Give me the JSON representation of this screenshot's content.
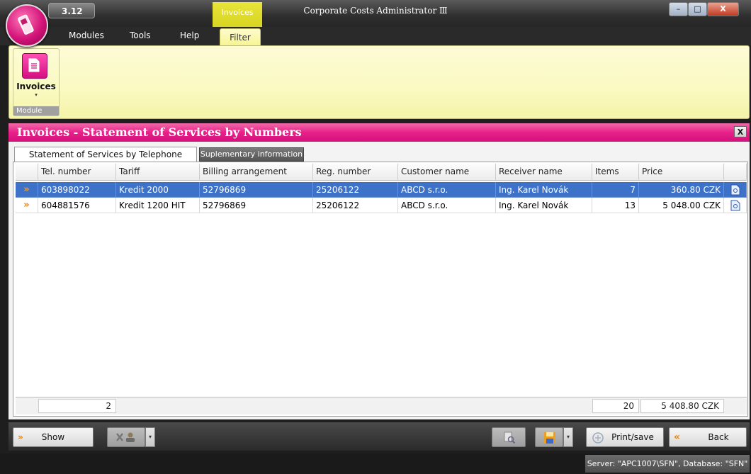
{
  "window": {
    "version": "3.12",
    "context_tab": "Invoices",
    "title": "Corporate Costs Administrator Ⅲ",
    "buttons": {
      "minimize": "–",
      "maximize": "□",
      "close": "X"
    }
  },
  "menu": {
    "items": [
      "Modules",
      "Tools",
      "Help"
    ],
    "active": "Filter"
  },
  "ribbon": {
    "button_label": "Invoices",
    "dropdown_arrow": "▾",
    "group_label": "Module"
  },
  "module": {
    "title": "Invoices - Statement of Services by  Numbers",
    "close_label": "X",
    "tabs": [
      "Statement of Services by Telephone Numbers",
      "Suplementary information"
    ]
  },
  "table": {
    "columns": [
      "Tel. number",
      "Tariff",
      "Billing arrangement",
      "Reg. number",
      "Customer name",
      "Receiver name",
      "Items",
      "Price"
    ],
    "rows": [
      {
        "tel": "603898022",
        "tariff": "Kredit 2000",
        "billing": "52796869",
        "reg": "25206122",
        "customer": "ABCD s.r.o.",
        "receiver": "Ing. Karel Novák",
        "items": "7",
        "price": "360.80 CZK",
        "selected": true
      },
      {
        "tel": "604881576",
        "tariff": "Kredit 1200 HIT",
        "billing": "52796869",
        "reg": "25206122",
        "customer": "ABCD s.r.o.",
        "receiver": "Ing. Karel Novák",
        "items": "13",
        "price": "5 048.00 CZK",
        "selected": false
      }
    ],
    "row_marker": "»",
    "totals": {
      "count": "2",
      "items": "20",
      "price": "5 408.80 CZK"
    }
  },
  "toolbar": {
    "show_label": "Show",
    "show_icon": "»",
    "print_label": "Print/save",
    "back_label": "Back",
    "back_icon": "«",
    "dropdown_arrow": "▾"
  },
  "status": {
    "text": "Server: \"APC1007\\SFN\", Database: \"SFN\""
  },
  "colors": {
    "accent": "#e8208a",
    "ribbon": "#fafac2",
    "selection": "#3d72c8",
    "row_marker": "#e8830c"
  }
}
